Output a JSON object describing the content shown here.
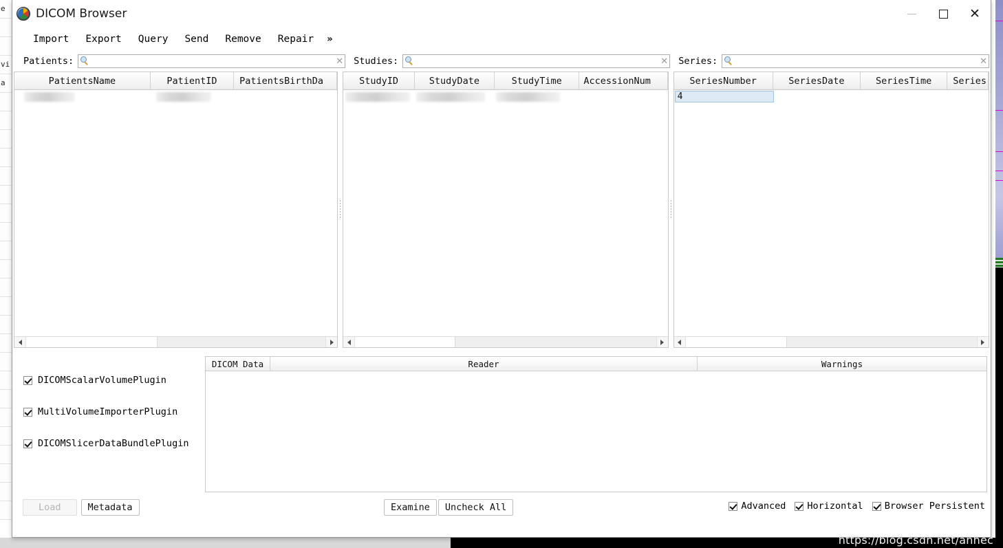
{
  "window": {
    "title": "DICOM Browser",
    "icon": "slicer-logo-icon",
    "minimize_label": "—",
    "maximize_label": "□",
    "close_label": "✕"
  },
  "toolbar": {
    "items": [
      {
        "label": "Import",
        "name": "import"
      },
      {
        "label": "Export",
        "name": "export"
      },
      {
        "label": "Query",
        "name": "query"
      },
      {
        "label": "Send",
        "name": "send"
      },
      {
        "label": "Remove",
        "name": "remove"
      },
      {
        "label": "Repair",
        "name": "repair"
      }
    ],
    "overflow_label": "»"
  },
  "filters": [
    {
      "label": "Patients:",
      "value": "",
      "placeholder": "",
      "clear_label": "✕",
      "icon": "magnifier-icon"
    },
    {
      "label": "Studies:",
      "value": "",
      "placeholder": "",
      "clear_label": "✕",
      "icon": "magnifier-icon"
    },
    {
      "label": "Series:",
      "value": "",
      "placeholder": "",
      "clear_label": "✕",
      "icon": "magnifier-icon"
    }
  ],
  "tables": {
    "patients": {
      "columns": [
        "PatientsName",
        "PatientID",
        "PatientsBirthDa"
      ],
      "rows": [
        {
          "PatientsName": "",
          "PatientID": "",
          "PatientsBirthDa": "",
          "redacted": true
        }
      ]
    },
    "studies": {
      "columns": [
        "StudyID",
        "StudyDate",
        "StudyTime",
        "AccessionNum"
      ],
      "rows": [
        {
          "StudyID": "",
          "StudyDate": "",
          "StudyTime": "",
          "AccessionNum": "",
          "redacted": true
        }
      ]
    },
    "series": {
      "columns": [
        "SeriesNumber",
        "SeriesDate",
        "SeriesTime",
        "Series"
      ],
      "rows": [
        {
          "SeriesNumber": "4",
          "SeriesDate": "",
          "SeriesTime": "",
          "Series": "",
          "selected": true
        }
      ]
    }
  },
  "plugins": [
    {
      "label": "DICOMScalarVolumePlugin",
      "checked": true
    },
    {
      "label": "MultiVolumeImporterPlugin",
      "checked": true
    },
    {
      "label": "DICOMSlicerDataBundlePlugin",
      "checked": true
    }
  ],
  "data_table": {
    "columns": [
      "DICOM Data",
      "Reader",
      "Warnings"
    ],
    "rows": []
  },
  "footer": {
    "load_label": "Load",
    "load_disabled": true,
    "metadata_label": "Metadata",
    "examine_label": "Examine",
    "uncheck_all_label": "Uncheck All",
    "options": [
      {
        "label": "Advanced",
        "checked": true
      },
      {
        "label": "Horizontal",
        "checked": true
      },
      {
        "label": "Browser Persistent",
        "checked": true
      }
    ]
  },
  "watermark": "https://blog.csdn.net/anhec",
  "background": {
    "left_rows": [
      "e",
      "",
      "",
      "vi",
      "a",
      "",
      "",
      "",
      "",
      "",
      "",
      "",
      "",
      "",
      "",
      "",
      "",
      "",
      "",
      "",
      "",
      "",
      "",
      "",
      "",
      "",
      "",
      "",
      ""
    ]
  },
  "colors": {
    "selection_bg": "#ddeaf5",
    "selection_border": "#9ec3e0",
    "window_border": "#9a9a9a",
    "header_grad_top": "#ffffff",
    "header_grad_bottom": "#ececec"
  }
}
